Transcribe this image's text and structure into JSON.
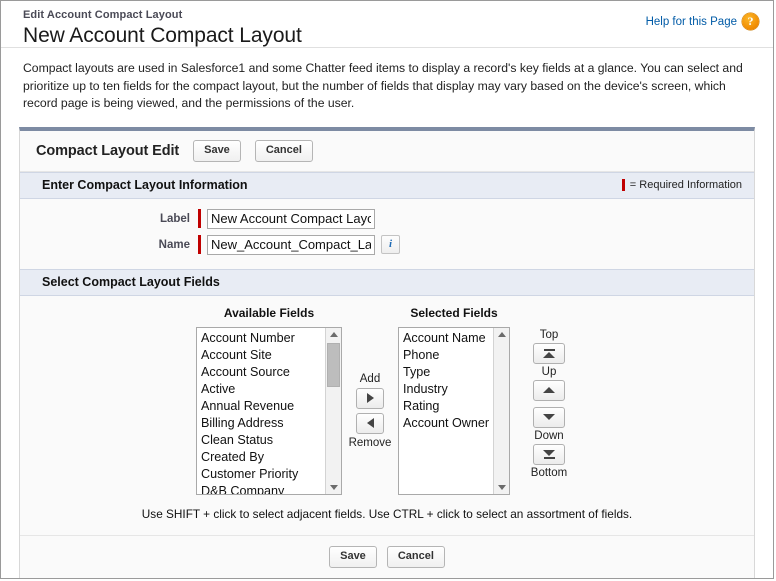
{
  "header": {
    "breadcrumb": "Edit Account Compact Layout",
    "title": "New Account Compact Layout",
    "help_label": "Help for this Page",
    "help_icon_glyph": "?"
  },
  "description": "Compact layouts are used in Salesforce1 and some Chatter feed items to display a record's key fields at a glance. You can select and prioritize up to ten fields for the compact layout, but the number of fields that display may vary based on the device's screen, which record page is being viewed, and the permissions of the user.",
  "panel": {
    "title": "Compact Layout Edit",
    "save_label": "Save",
    "cancel_label": "Cancel"
  },
  "info_section": {
    "heading": "Enter Compact Layout Information",
    "required_legend": "= Required Information",
    "required_color": "#c00000",
    "fields": [
      {
        "label": "Label",
        "value": "New Account Compact Layo",
        "required": true
      },
      {
        "label": "Name",
        "value": "New_Account_Compact_Lay",
        "required": true
      }
    ],
    "info_icon_glyph": "i"
  },
  "fields_section": {
    "heading": "Select Compact Layout Fields",
    "available_header": "Available Fields",
    "selected_header": "Selected Fields",
    "available_fields": [
      "Account Number",
      "Account Site",
      "Account Source",
      "Active",
      "Annual Revenue",
      "Billing Address",
      "Clean Status",
      "Created By",
      "Customer Priority",
      "D&B Company"
    ],
    "selected_fields": [
      "Account Name",
      "Phone",
      "Type",
      "Industry",
      "Rating",
      "Account Owner"
    ],
    "add_label": "Add",
    "remove_label": "Remove",
    "top_label": "Top",
    "up_label": "Up",
    "down_label": "Down",
    "bottom_label": "Bottom",
    "hint": "Use SHIFT + click to select adjacent fields. Use CTRL + click to select an assortment of fields."
  },
  "footer": {
    "save_label": "Save",
    "cancel_label": "Cancel"
  }
}
